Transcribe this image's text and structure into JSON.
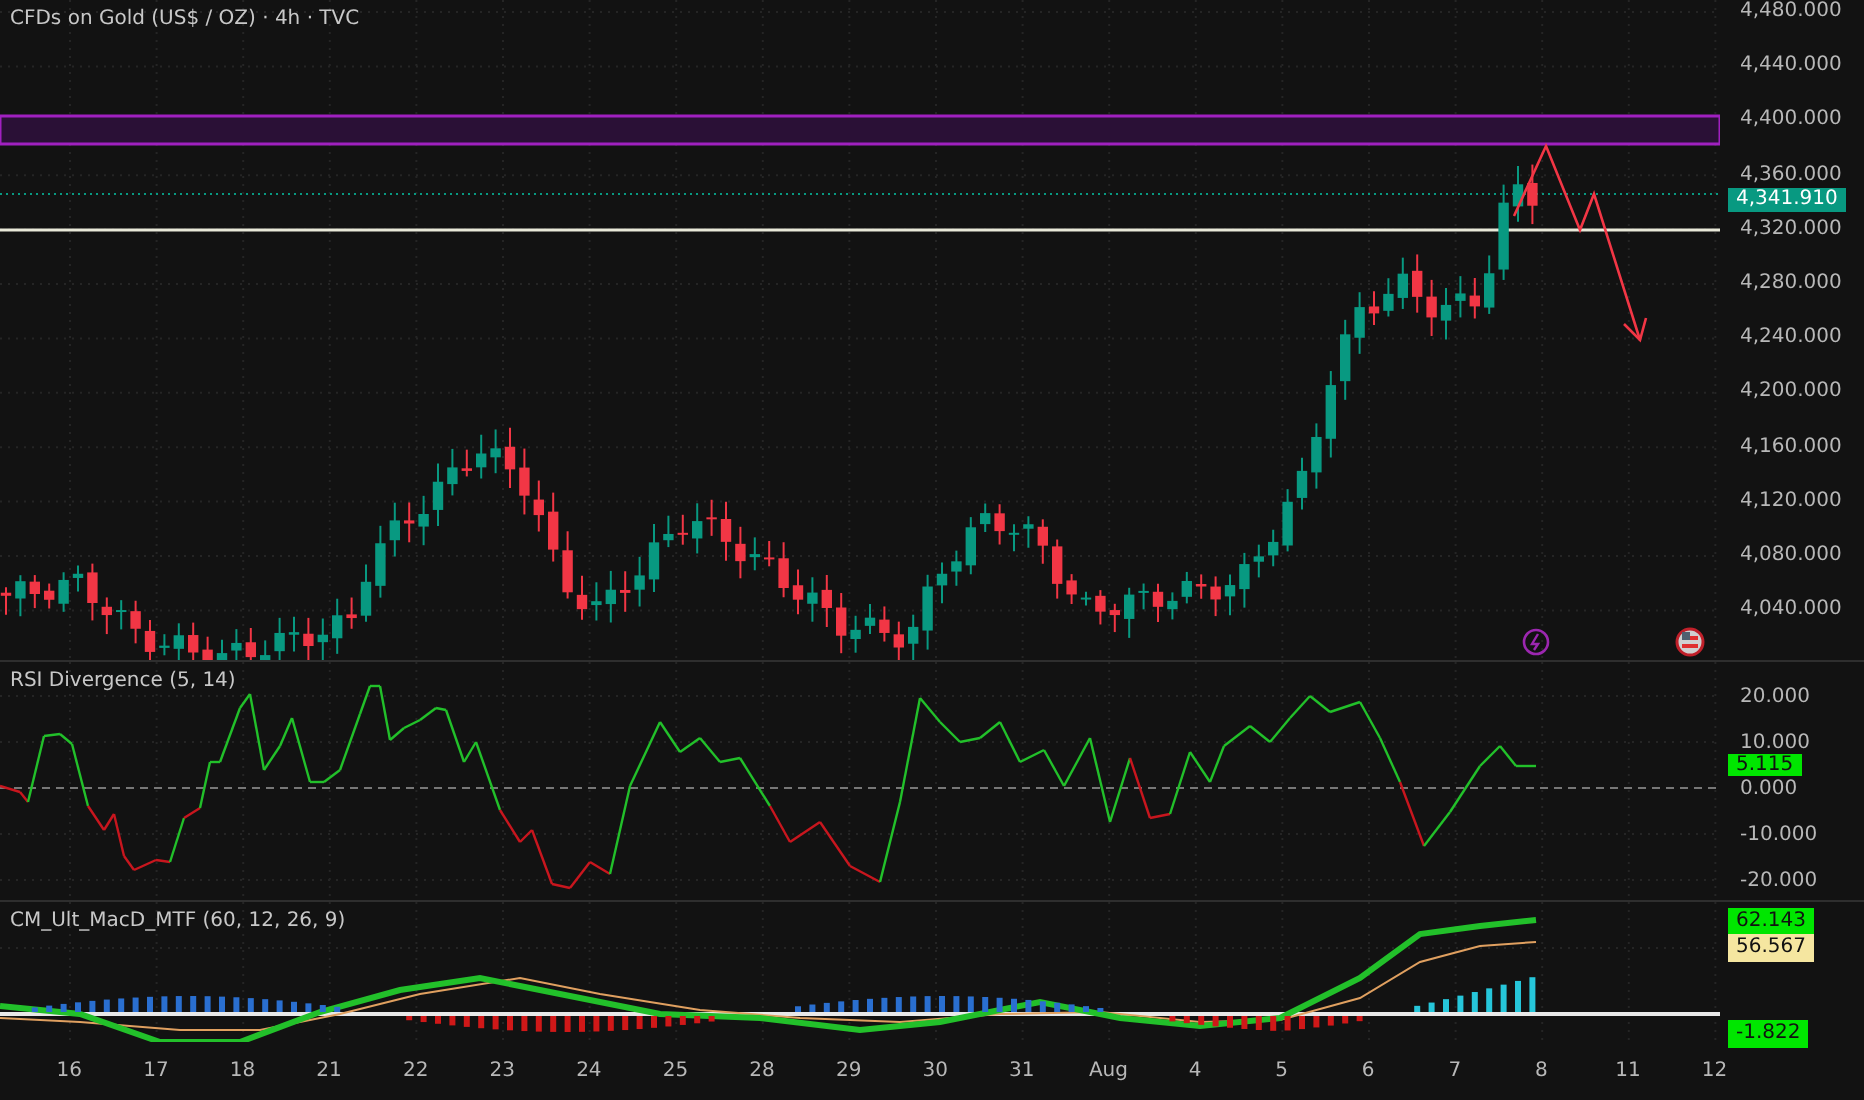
{
  "chart": {
    "title": "CFDs on Gold (US$ / OZ) · 4h · TVC",
    "price_axis": [
      "4,480.000",
      "4,440.000",
      "4,400.000",
      "4,360.000",
      "4,320.000",
      "4,280.000",
      "4,240.000",
      "4,200.000",
      "4,160.000",
      "4,120.000",
      "4,080.000",
      "4,040.000"
    ],
    "last_price": "4,341.910"
  },
  "rsi": {
    "title": "RSI Divergence (5, 14)",
    "axis": [
      "20.000",
      "10.000",
      "0.000",
      "-10.000",
      "-20.000"
    ],
    "last_value": "5.115"
  },
  "macd": {
    "title": "CM_Ult_MacD_MTF (60, 12, 26, 9)",
    "values": [
      {
        "text": "62.143",
        "color": "#00e600"
      },
      {
        "text": "56.567",
        "color": "#f5e6a0"
      },
      {
        "text": "-1.822",
        "color": "#00e600"
      }
    ]
  },
  "time_axis": [
    "16",
    "17",
    "18",
    "21",
    "22",
    "23",
    "24",
    "25",
    "28",
    "29",
    "30",
    "31",
    "Aug",
    "4",
    "5",
    "6",
    "7",
    "8",
    "11",
    "12"
  ]
}
